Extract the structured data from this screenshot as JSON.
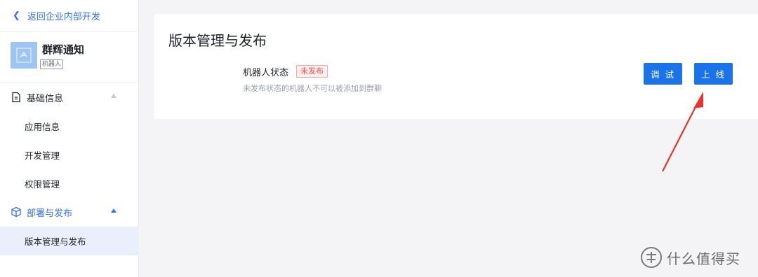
{
  "sidebar": {
    "back_label": "返回企业内部开发",
    "app": {
      "name": "群辉通知",
      "tag": "机器人"
    },
    "groups": [
      {
        "label": "基础信息",
        "icon": "document-icon",
        "expanded": true,
        "items": [
          "应用信息",
          "开发管理",
          "权限管理"
        ]
      },
      {
        "label": "部署与发布",
        "icon": "cube-icon",
        "expanded": true,
        "active": true,
        "items": [
          "版本管理与发布"
        ]
      }
    ],
    "selected_item": "版本管理与发布"
  },
  "main": {
    "title": "版本管理与发布",
    "status_label": "机器人状态",
    "status_badge": "未发布",
    "status_hint": "未发布状态的机器人不可以被添加到群聊",
    "buttons": {
      "debug": "调 试",
      "online": "上 线"
    }
  },
  "watermark": {
    "text": "什么值得买"
  },
  "colors": {
    "accent": "#1a73e8",
    "link": "#3370ff",
    "badge_red": "#f54a45",
    "selected_bg": "#e9f0fc",
    "arrow_red": "#e8322c"
  }
}
